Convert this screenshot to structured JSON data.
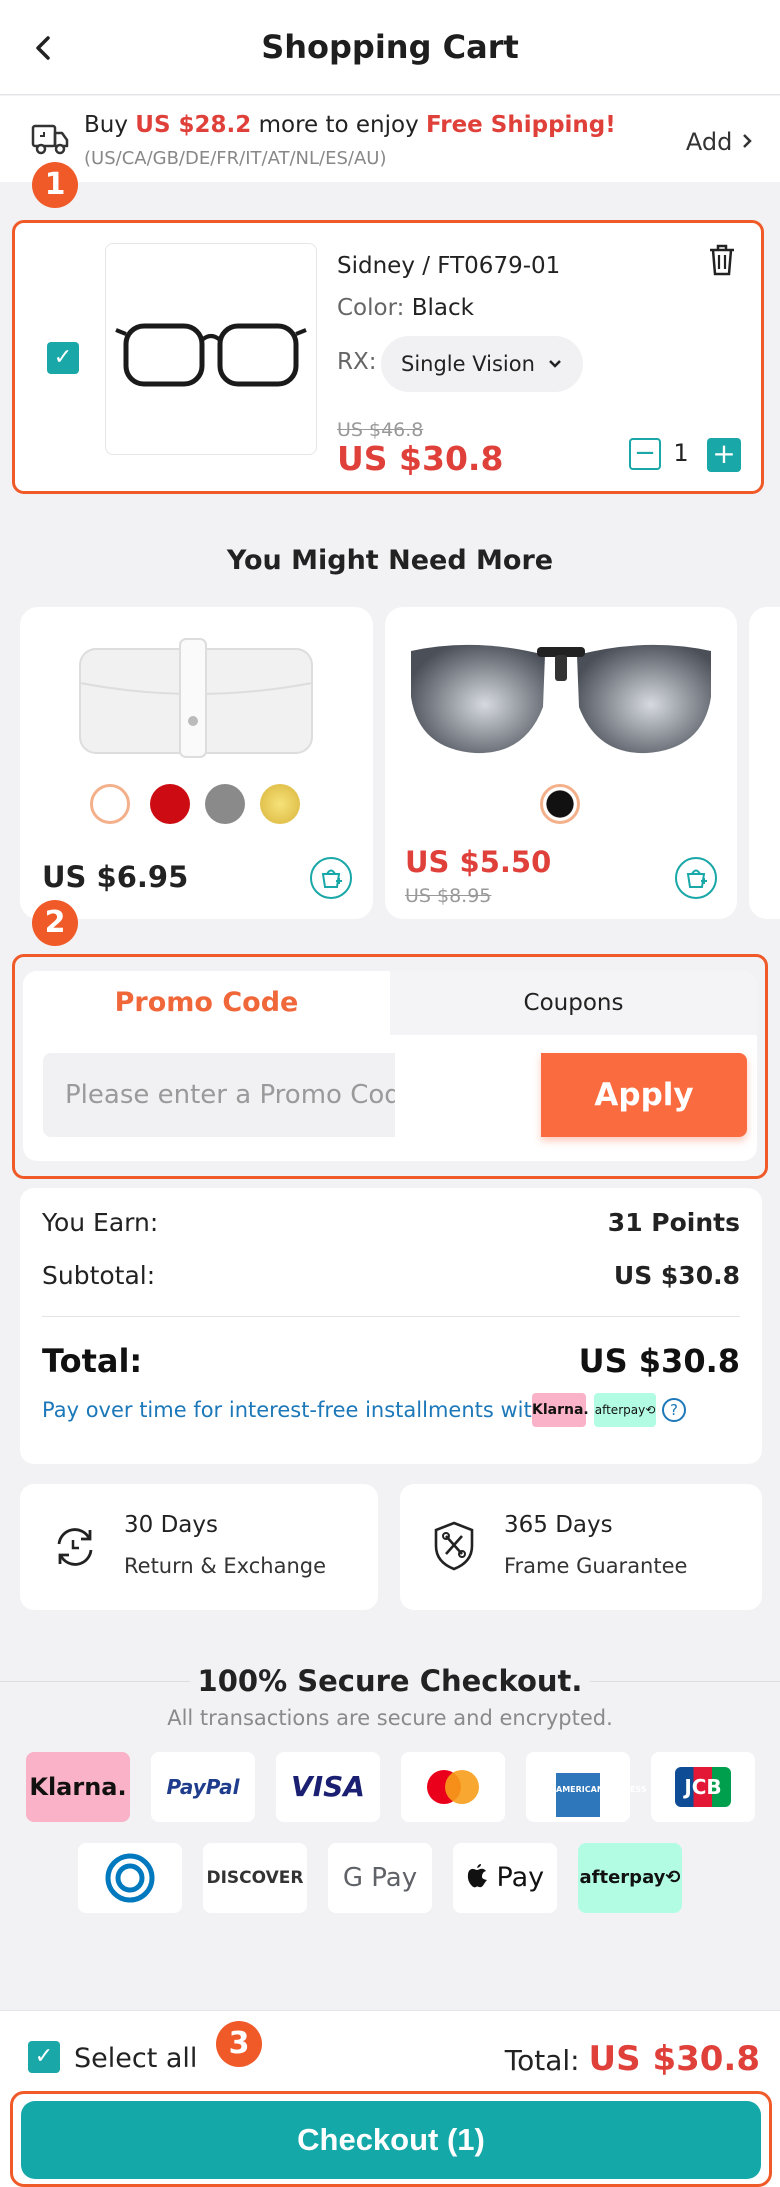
{
  "header": {
    "title": "Shopping Cart",
    "back_icon": "‹"
  },
  "shipping": {
    "pre": "Buy ",
    "amount": "US $28.2",
    "mid": " more to enjoy ",
    "highlight": "Free Shipping!",
    "regions": "(US/CA/GB/DE/FR/IT/AT/NL/ES/AU)",
    "add_label": "Add"
  },
  "annotations": {
    "one": "1",
    "two": "2",
    "three": "3"
  },
  "cart_item": {
    "name": "Sidney / FT0679-01",
    "color_label": "Color:",
    "color_value": "Black",
    "rx_label": "RX:",
    "rx_value": "Single Vision",
    "old_price": "US $46.8",
    "price": "US $30.8",
    "quantity": "1",
    "checked": true
  },
  "recommend": {
    "title": "You Might Need More",
    "items": [
      {
        "price": "US $6.95",
        "swatches": [
          "#ffffff",
          "#cc0c12",
          "#8a8a8a",
          "#e8c74a"
        ]
      },
      {
        "price": "US $5.50",
        "old_price": "US $8.95",
        "swatches": [
          "#111111"
        ]
      }
    ]
  },
  "promo": {
    "tab_promo": "Promo Code",
    "tab_coupons": "Coupons",
    "placeholder": "Please enter a Promo Code",
    "apply_label": "Apply"
  },
  "summary": {
    "earn_label": "You Earn:",
    "earn_value": "31 Points",
    "subtotal_label": "Subtotal:",
    "subtotal_value": "US $30.8",
    "total_label": "Total:",
    "total_value": "US $30.8",
    "installments": "Pay over time for interest-free installments with",
    "klarna": "Klarna.",
    "afterpay": "afterpay⟲"
  },
  "guarantees": [
    {
      "line1": "30 Days",
      "line2": "Return & Exchange"
    },
    {
      "line1": "365 Days",
      "line2": "Frame Guarantee"
    }
  ],
  "secure": {
    "title": "100% Secure Checkout.",
    "subtitle": "All transactions are secure and encrypted.",
    "logos": [
      "Klarna.",
      "PayPal",
      "VISA",
      "Mastercard",
      "AMERICAN EXPRESS",
      "JCB",
      "Diners Club",
      "DISCOVER",
      "G Pay",
      "Pay",
      "afterpay⟲"
    ]
  },
  "footer": {
    "select_all": "Select all",
    "total_label": "Total:",
    "total_value": "US $30.8",
    "checkout_label": "Checkout (1)"
  },
  "colors": {
    "accent": "#14a9a8",
    "price_red": "#e0403a",
    "orange": "#f05a28",
    "apply": "#fa6b3f"
  }
}
